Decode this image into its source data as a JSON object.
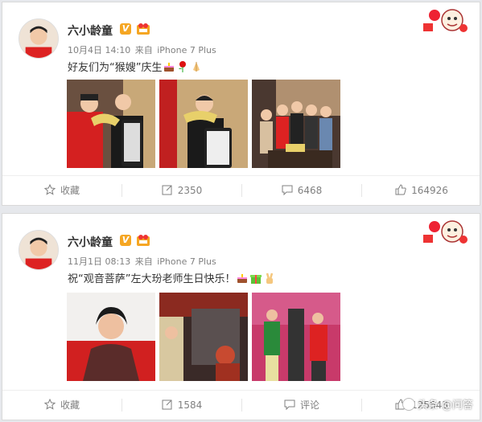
{
  "posts": [
    {
      "author": "六小龄童",
      "date": "10月4日 14:10",
      "source_prefix": "来自",
      "device": "iPhone 7 Plus",
      "text": "好友们为“猴嫂”庆生",
      "emojis": [
        "cake-icon",
        "rose-icon",
        "prayer-hands-icon"
      ],
      "actions": {
        "favorite": "收藏",
        "repost": "2350",
        "comment": "6468",
        "like": "164926"
      }
    },
    {
      "author": "六小龄童",
      "date": "11月1日 08:13",
      "source_prefix": "来自",
      "device": "iPhone 7 Plus",
      "text": "祝“观音菩萨”左大玢老师生日快乐！",
      "emojis": [
        "cake-icon",
        "gift-icon",
        "victory-hand-icon"
      ],
      "actions": {
        "favorite": "收藏",
        "repost": "1584",
        "comment": "评论",
        "like": "125543"
      }
    }
  ],
  "watermark": "头条 @问答",
  "colors": {
    "accent": "#f5a623",
    "meta": "#808080",
    "text": "#333333"
  }
}
